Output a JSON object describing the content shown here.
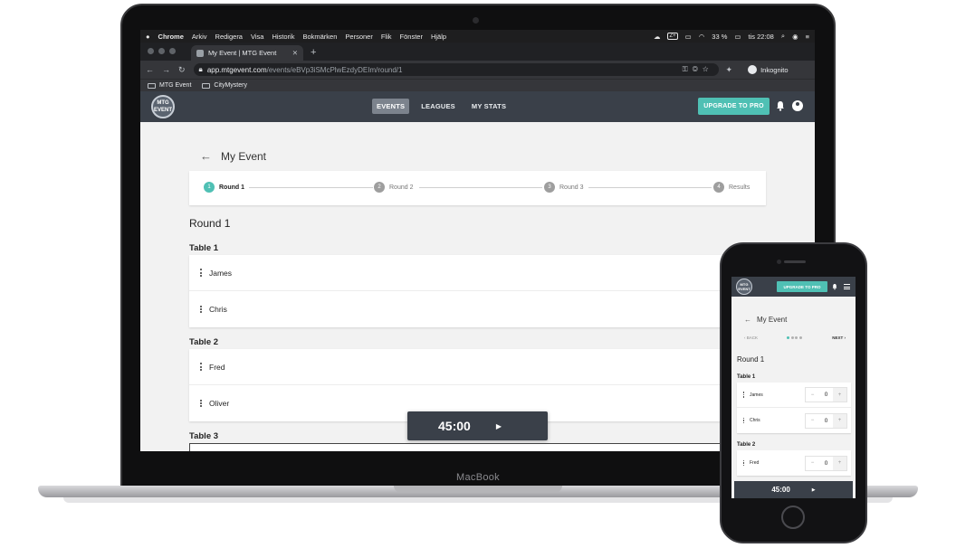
{
  "mac_menubar": {
    "apple": "",
    "items": [
      "Chrome",
      "Arkiv",
      "Redigera",
      "Visa",
      "Historik",
      "Bokmärken",
      "Personer",
      "Flik",
      "Fönster",
      "Hjälp"
    ],
    "status": {
      "battery": "33 %",
      "time": "tis 22:08"
    }
  },
  "browser": {
    "tab_title": "My Event | MTG Event",
    "url_host": "app.mtgevent.com",
    "url_path": "/events/eBVp3iSMcPlwEzdyDEIm/round/1",
    "profile_label": "Inkognito",
    "bookmarks": [
      "MTG Event",
      "CityMystery"
    ]
  },
  "app": {
    "logo_text": "MTG EVENT",
    "nav": [
      "EVENTS",
      "LEAGUES",
      "MY STATS"
    ],
    "upgrade_label": "UPGRADE TO PRO",
    "page_title": "My Event",
    "steps": [
      {
        "num": "1",
        "label": "Round 1"
      },
      {
        "num": "2",
        "label": "Round 2"
      },
      {
        "num": "3",
        "label": "Round 3"
      },
      {
        "num": "4",
        "label": "Results"
      }
    ],
    "round_title": "Round 1",
    "tables": [
      {
        "title": "Table 1",
        "players": [
          "James",
          "Chris"
        ]
      },
      {
        "title": "Table 2",
        "players": [
          "Fred",
          "Oliver"
        ]
      },
      {
        "title": "Table 3",
        "players": []
      }
    ],
    "minus_symbol": "—",
    "timer": "45:00",
    "play_symbol": "▶"
  },
  "laptop": {
    "brand": "MacBook"
  },
  "phone": {
    "upgrade_label": "UPGRADE TO PRO",
    "page_title": "My Event",
    "back_label": "‹ BACK",
    "next_label": "NEXT ›",
    "round_title": "Round 1",
    "tables": [
      {
        "title": "Table 1",
        "players": [
          {
            "name": "James",
            "score": "0"
          },
          {
            "name": "Chris",
            "score": "0"
          }
        ]
      },
      {
        "title": "Table 2",
        "players": [
          {
            "name": "Fred",
            "score": "0"
          }
        ]
      }
    ],
    "minus_symbol": "−",
    "plus_symbol": "+",
    "timer": "45:00"
  },
  "colors": {
    "accent": "#4fc0b4",
    "header": "#3a4049",
    "background": "#f2f2f2"
  },
  "icons": [
    "back-arrow-icon",
    "bell-icon",
    "account-icon",
    "drag-handle-icon",
    "play-icon",
    "menu-icon"
  ]
}
